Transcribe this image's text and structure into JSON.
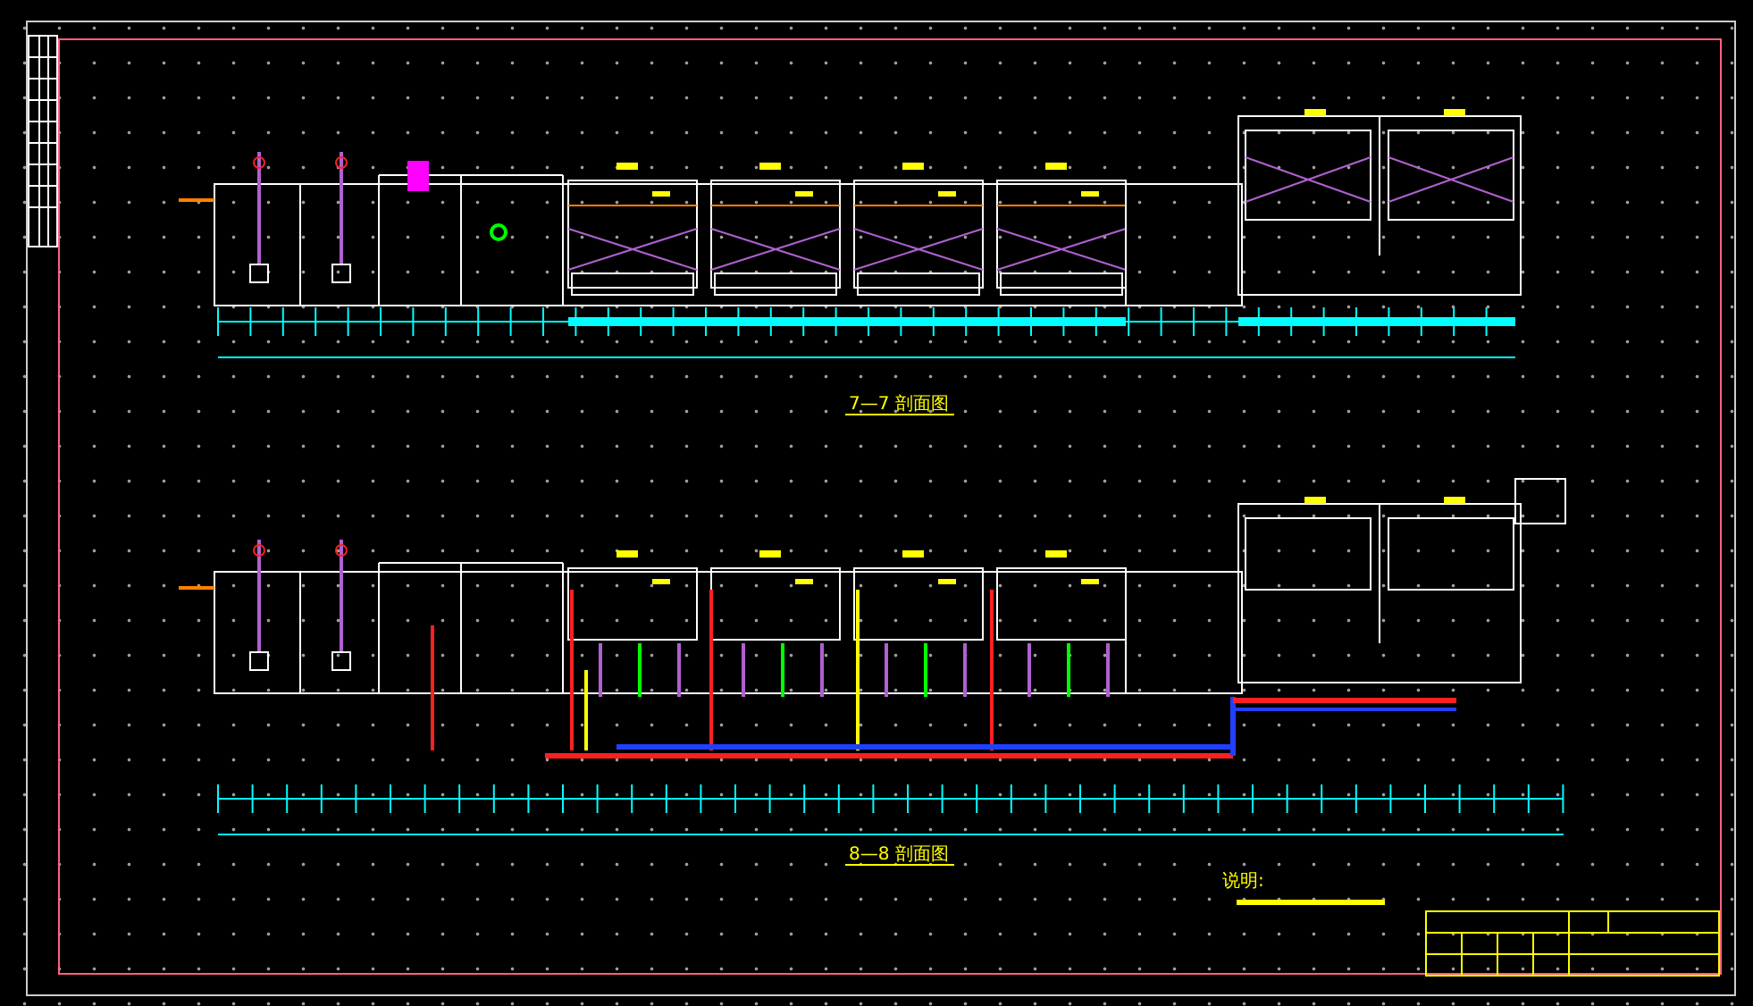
{
  "drawing": {
    "sections": [
      {
        "title": "7—7 剖面图"
      },
      {
        "title": "8—8 剖面图"
      }
    ],
    "notes": {
      "heading": "说明:"
    }
  }
}
